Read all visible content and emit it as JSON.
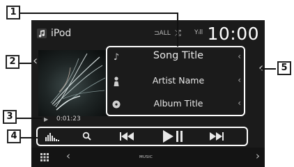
{
  "header": {
    "source_label": "iPod",
    "repeat_indicator": "⊐ALL",
    "shuffle_indicator": "⤮",
    "signal_indicator": "Yᵢll",
    "clock": "10:00"
  },
  "track": {
    "title": "Song Title",
    "artist": "Artist Name",
    "album": "Album Title"
  },
  "playback": {
    "elapsed": "0:01:23"
  },
  "controls": {
    "equalizer": "equalizer",
    "search": "search",
    "previous": "⏮",
    "play_pause": "⏯",
    "next": "⏭"
  },
  "bottombar": {
    "label": "MUSIC"
  },
  "callouts": {
    "c1": "1",
    "c2": "2",
    "c3": "3",
    "c4": "4",
    "c5": "5"
  },
  "colors": {
    "screen_bg": "#1b1b1b",
    "frame": "#ffffff",
    "text": "#e8e8e8"
  }
}
